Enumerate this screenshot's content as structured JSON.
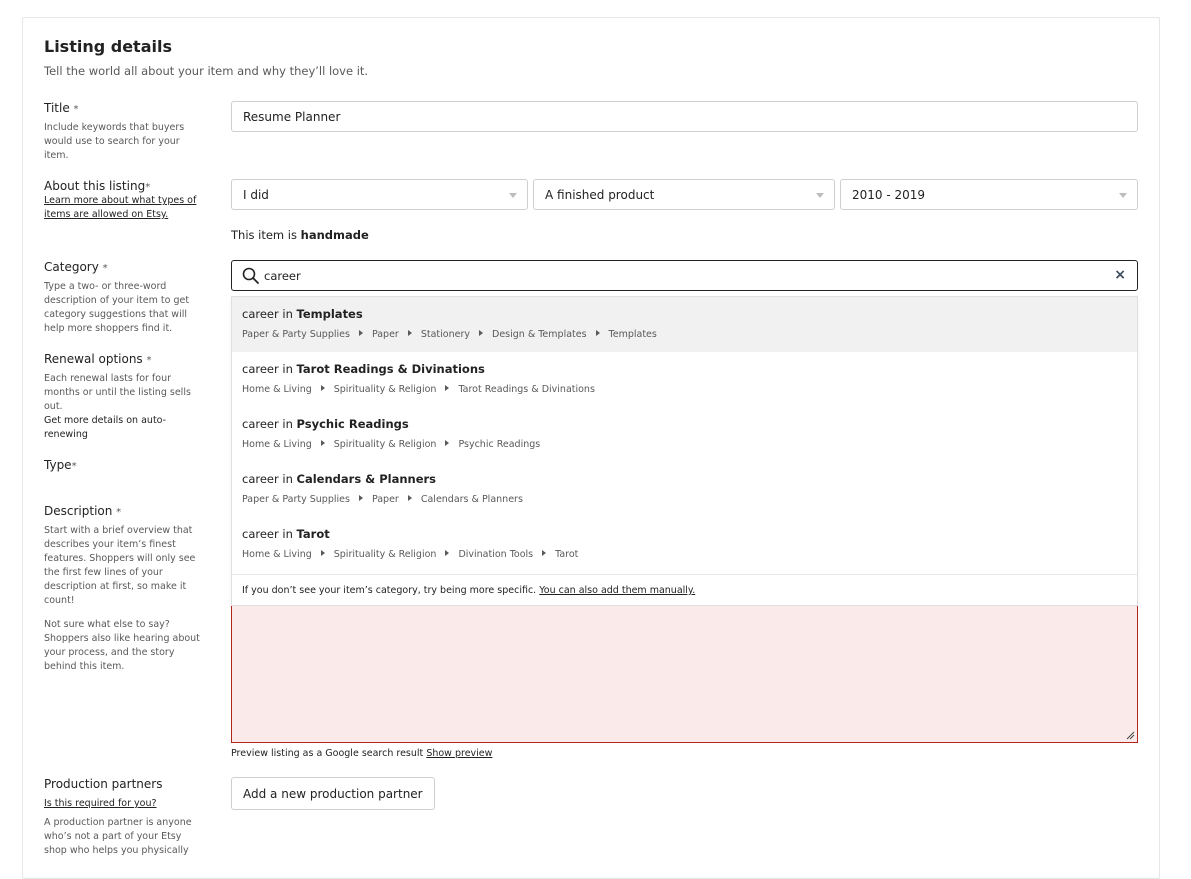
{
  "section": {
    "title": "Listing details",
    "subtitle": "Tell the world all about your item and why they’ll love it."
  },
  "title_field": {
    "label": "Title",
    "required": "*",
    "help": "Include keywords that buyers would use to search for your item.",
    "value": "Resume Planner"
  },
  "about": {
    "label": "About this listing",
    "required": "*",
    "link": "Learn more about what types of items are allowed on Etsy.",
    "who_made": "I did",
    "what_is_it": "A finished product",
    "when_made": "2010 - 2019",
    "status_prefix": "This item is",
    "status_value": "handmade"
  },
  "category": {
    "label": "Category",
    "required": "*",
    "help": "Type a two- or three-word description of your item to get category suggestions that will help more shoppers find it.",
    "search_value": "career",
    "clear_symbol": "×",
    "suggestions": [
      {
        "prefix": "career in",
        "name": "Templates",
        "path": [
          "Paper & Party Supplies",
          "Paper",
          "Stationery",
          "Design & Templates",
          "Templates"
        ]
      },
      {
        "prefix": "career in",
        "name": "Tarot Readings & Divinations",
        "path": [
          "Home & Living",
          "Spirituality & Religion",
          "Tarot Readings & Divinations"
        ]
      },
      {
        "prefix": "career in",
        "name": "Psychic Readings",
        "path": [
          "Home & Living",
          "Spirituality & Religion",
          "Psychic Readings"
        ]
      },
      {
        "prefix": "career in",
        "name": "Calendars & Planners",
        "path": [
          "Paper & Party Supplies",
          "Paper",
          "Calendars & Planners"
        ]
      },
      {
        "prefix": "career in",
        "name": "Tarot",
        "path": [
          "Home & Living",
          "Spirituality & Religion",
          "Divination Tools",
          "Tarot"
        ]
      }
    ],
    "footer_text": "If you don’t see your item’s category, try being more specific.",
    "footer_link": "You can also add them manually."
  },
  "renewal": {
    "label": "Renewal options",
    "required": "*",
    "help": "Each renewal lasts for four months or until the listing sells out.",
    "help2": "Get more details on auto-renewing"
  },
  "type": {
    "label": "Type",
    "required": "*"
  },
  "description": {
    "label": "Description",
    "required": "*",
    "help": "Start with a brief overview that describes your item’s finest features. Shoppers will only see the first few lines of your description at first, so make it count!",
    "help2": "Not sure what else to say? Shoppers also like hearing about your process, and the story behind this item.",
    "preview_text": "Preview listing as a Google search result",
    "preview_link": "Show preview"
  },
  "production": {
    "label": "Production partners",
    "link": "Is this required for you?",
    "help": "A production partner is anyone who’s not a part of your Etsy shop who helps you physically",
    "button": "Add a new production partner"
  },
  "colors": {
    "error_border": "#b3261e",
    "error_fill": "#fbeaea",
    "active_suggestion": "#f1f1f1"
  }
}
